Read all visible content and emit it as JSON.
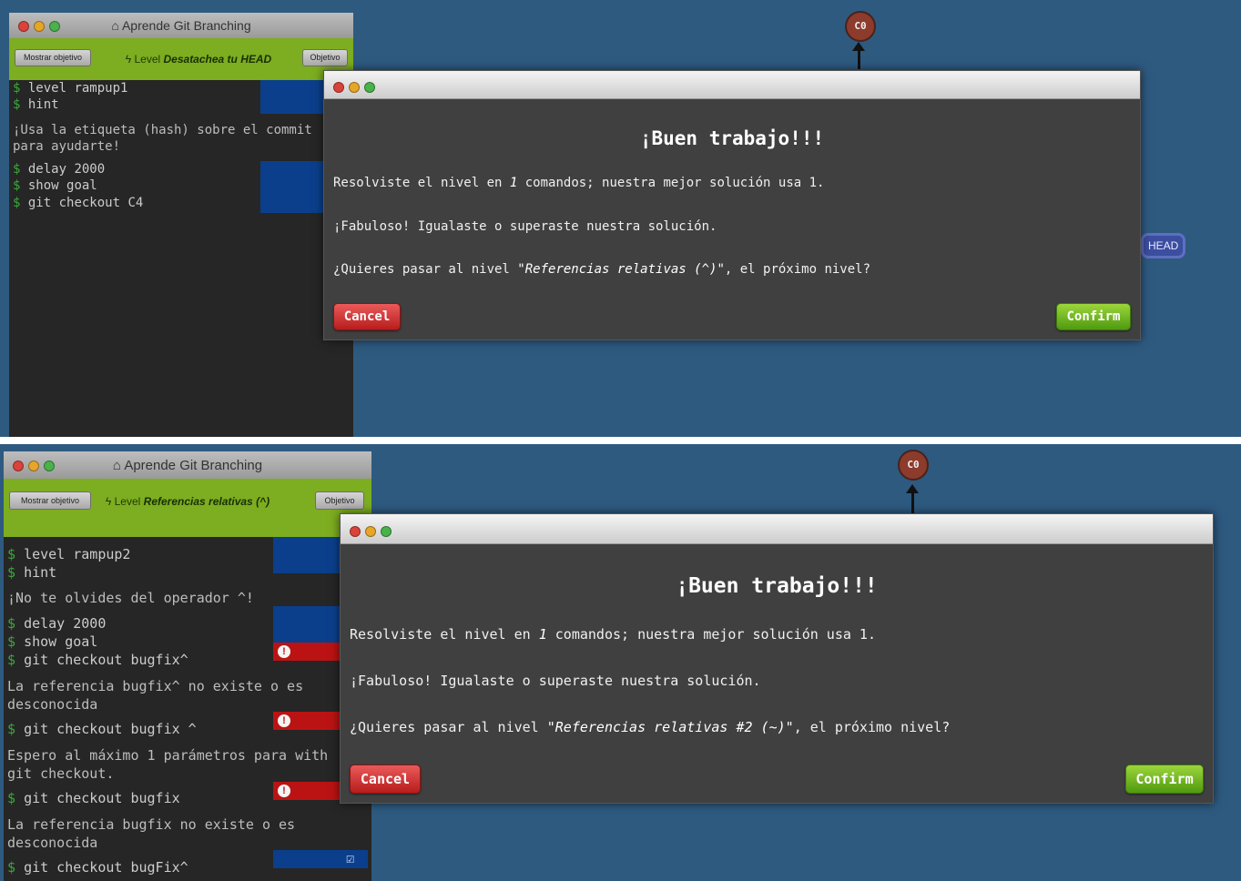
{
  "app": {
    "title": "Aprende Git Branching",
    "mostrar_objetivo": "Mostrar objetivo",
    "objetivo": "Objetivo"
  },
  "colors": {
    "background": "#2e5a80",
    "level_bar": "#7dad20",
    "commit": "#8c3b2c",
    "confirm": "#4f9a0f",
    "cancel": "#b81d1d"
  },
  "panels": [
    {
      "level_prefix": "Level",
      "level_name": "Desatachea tu HEAD",
      "commit_label": "C0",
      "head_label": "HEAD",
      "terminal": {
        "lines": [
          {
            "kind": "cmd",
            "text": "level rampup1",
            "status": "ok"
          },
          {
            "kind": "cmd",
            "text": "hint",
            "status": "ok"
          },
          {
            "kind": "msg",
            "text": "¡Usa la etiqueta (hash) sobre el commit para ayudarte!"
          },
          {
            "kind": "cmd",
            "text": "delay 2000",
            "status": "ok"
          },
          {
            "kind": "cmd",
            "text": "show goal",
            "status": "ok"
          },
          {
            "kind": "cmd",
            "text": "git checkout C4",
            "status": "ok"
          }
        ]
      },
      "modal": {
        "title": "¡Buen trabajo!!!",
        "line1_a": "Resolviste el nivel en ",
        "line1_count": "1",
        "line1_b": " comandos; nuestra mejor solución usa 1.",
        "line2": "¡Fabuloso! Igualaste o superaste nuestra solución.",
        "line3_a": "¿Quieres pasar al nivel ",
        "line3_level": "\"Referencias relativas (^)\"",
        "line3_b": ", el próximo nivel?",
        "cancel": "Cancel",
        "confirm": "Confirm"
      }
    },
    {
      "level_prefix": "Level",
      "level_name": "Referencias relativas (^)",
      "commit_label": "C0",
      "terminal": {
        "lines": [
          {
            "kind": "cmd",
            "text": "level rampup2",
            "status": "ok"
          },
          {
            "kind": "cmd",
            "text": "hint",
            "status": "ok"
          },
          {
            "kind": "msg",
            "text": "¡No te olvides del operador ^!"
          },
          {
            "kind": "cmd",
            "text": "delay 2000",
            "status": "ok"
          },
          {
            "kind": "cmd",
            "text": "show goal",
            "status": "ok"
          },
          {
            "kind": "cmd",
            "text": "git checkout bugfix^",
            "status": "error"
          },
          {
            "kind": "msg",
            "text": "La referencia bugfix^ no existe o es desconocida"
          },
          {
            "kind": "cmd",
            "text": "git checkout bugfix ^",
            "status": "error"
          },
          {
            "kind": "msg",
            "text": "Espero al máximo 1 parámetros para with git checkout."
          },
          {
            "kind": "cmd",
            "text": "git checkout bugfix",
            "status": "error"
          },
          {
            "kind": "msg",
            "text": "La referencia bugfix no existe o es desconocida"
          },
          {
            "kind": "cmd",
            "text": "git checkout bugFix^",
            "status": "success"
          }
        ]
      },
      "modal": {
        "title": "¡Buen trabajo!!!",
        "line1_a": "Resolviste el nivel en ",
        "line1_count": "1",
        "line1_b": " comandos; nuestra mejor solución usa 1.",
        "line2": "¡Fabuloso! Igualaste o superaste nuestra solución.",
        "line3_a": "¿Quieres pasar al nivel ",
        "line3_level": "\"Referencias relativas #2 (~)\"",
        "line3_b": ", el próximo nivel?",
        "cancel": "Cancel",
        "confirm": "Confirm"
      }
    }
  ]
}
